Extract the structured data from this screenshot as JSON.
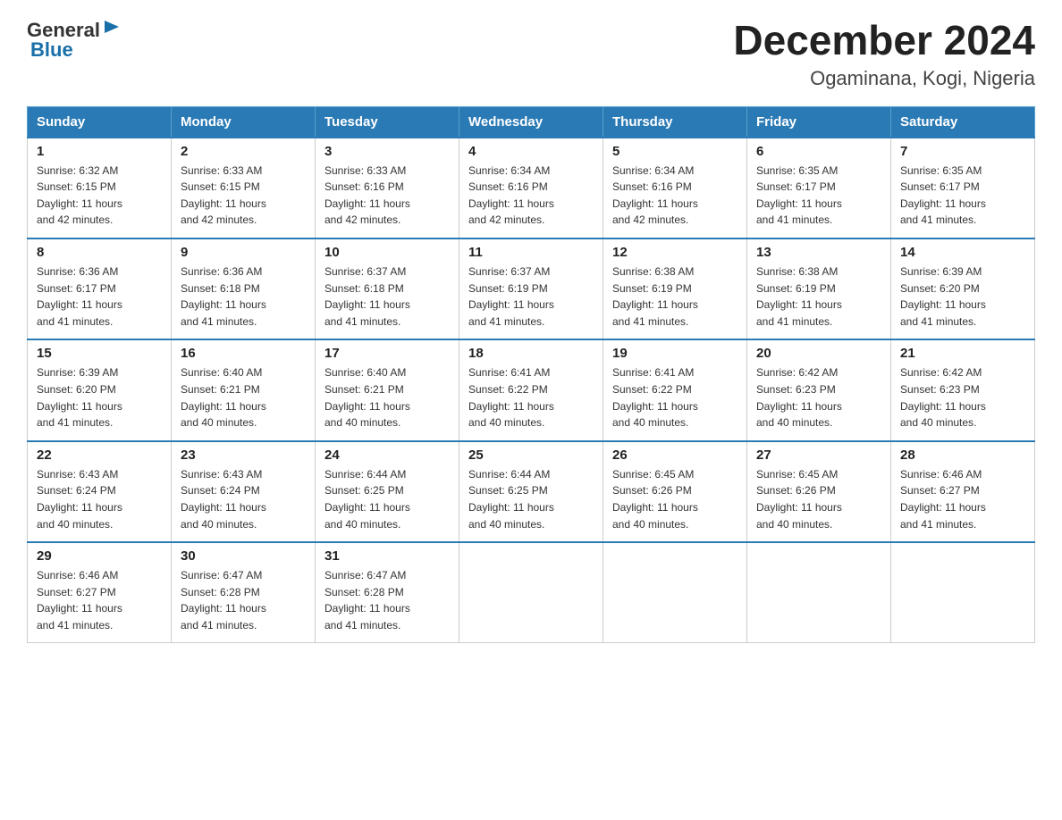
{
  "header": {
    "logo_general": "General",
    "logo_blue": "Blue",
    "month": "December 2024",
    "location": "Ogaminana, Kogi, Nigeria"
  },
  "weekdays": [
    "Sunday",
    "Monday",
    "Tuesday",
    "Wednesday",
    "Thursday",
    "Friday",
    "Saturday"
  ],
  "weeks": [
    [
      {
        "day": "1",
        "sunrise": "6:32 AM",
        "sunset": "6:15 PM",
        "daylight": "11 hours and 42 minutes."
      },
      {
        "day": "2",
        "sunrise": "6:33 AM",
        "sunset": "6:15 PM",
        "daylight": "11 hours and 42 minutes."
      },
      {
        "day": "3",
        "sunrise": "6:33 AM",
        "sunset": "6:16 PM",
        "daylight": "11 hours and 42 minutes."
      },
      {
        "day": "4",
        "sunrise": "6:34 AM",
        "sunset": "6:16 PM",
        "daylight": "11 hours and 42 minutes."
      },
      {
        "day": "5",
        "sunrise": "6:34 AM",
        "sunset": "6:16 PM",
        "daylight": "11 hours and 42 minutes."
      },
      {
        "day": "6",
        "sunrise": "6:35 AM",
        "sunset": "6:17 PM",
        "daylight": "11 hours and 41 minutes."
      },
      {
        "day": "7",
        "sunrise": "6:35 AM",
        "sunset": "6:17 PM",
        "daylight": "11 hours and 41 minutes."
      }
    ],
    [
      {
        "day": "8",
        "sunrise": "6:36 AM",
        "sunset": "6:17 PM",
        "daylight": "11 hours and 41 minutes."
      },
      {
        "day": "9",
        "sunrise": "6:36 AM",
        "sunset": "6:18 PM",
        "daylight": "11 hours and 41 minutes."
      },
      {
        "day": "10",
        "sunrise": "6:37 AM",
        "sunset": "6:18 PM",
        "daylight": "11 hours and 41 minutes."
      },
      {
        "day": "11",
        "sunrise": "6:37 AM",
        "sunset": "6:19 PM",
        "daylight": "11 hours and 41 minutes."
      },
      {
        "day": "12",
        "sunrise": "6:38 AM",
        "sunset": "6:19 PM",
        "daylight": "11 hours and 41 minutes."
      },
      {
        "day": "13",
        "sunrise": "6:38 AM",
        "sunset": "6:19 PM",
        "daylight": "11 hours and 41 minutes."
      },
      {
        "day": "14",
        "sunrise": "6:39 AM",
        "sunset": "6:20 PM",
        "daylight": "11 hours and 41 minutes."
      }
    ],
    [
      {
        "day": "15",
        "sunrise": "6:39 AM",
        "sunset": "6:20 PM",
        "daylight": "11 hours and 41 minutes."
      },
      {
        "day": "16",
        "sunrise": "6:40 AM",
        "sunset": "6:21 PM",
        "daylight": "11 hours and 40 minutes."
      },
      {
        "day": "17",
        "sunrise": "6:40 AM",
        "sunset": "6:21 PM",
        "daylight": "11 hours and 40 minutes."
      },
      {
        "day": "18",
        "sunrise": "6:41 AM",
        "sunset": "6:22 PM",
        "daylight": "11 hours and 40 minutes."
      },
      {
        "day": "19",
        "sunrise": "6:41 AM",
        "sunset": "6:22 PM",
        "daylight": "11 hours and 40 minutes."
      },
      {
        "day": "20",
        "sunrise": "6:42 AM",
        "sunset": "6:23 PM",
        "daylight": "11 hours and 40 minutes."
      },
      {
        "day": "21",
        "sunrise": "6:42 AM",
        "sunset": "6:23 PM",
        "daylight": "11 hours and 40 minutes."
      }
    ],
    [
      {
        "day": "22",
        "sunrise": "6:43 AM",
        "sunset": "6:24 PM",
        "daylight": "11 hours and 40 minutes."
      },
      {
        "day": "23",
        "sunrise": "6:43 AM",
        "sunset": "6:24 PM",
        "daylight": "11 hours and 40 minutes."
      },
      {
        "day": "24",
        "sunrise": "6:44 AM",
        "sunset": "6:25 PM",
        "daylight": "11 hours and 40 minutes."
      },
      {
        "day": "25",
        "sunrise": "6:44 AM",
        "sunset": "6:25 PM",
        "daylight": "11 hours and 40 minutes."
      },
      {
        "day": "26",
        "sunrise": "6:45 AM",
        "sunset": "6:26 PM",
        "daylight": "11 hours and 40 minutes."
      },
      {
        "day": "27",
        "sunrise": "6:45 AM",
        "sunset": "6:26 PM",
        "daylight": "11 hours and 40 minutes."
      },
      {
        "day": "28",
        "sunrise": "6:46 AM",
        "sunset": "6:27 PM",
        "daylight": "11 hours and 41 minutes."
      }
    ],
    [
      {
        "day": "29",
        "sunrise": "6:46 AM",
        "sunset": "6:27 PM",
        "daylight": "11 hours and 41 minutes."
      },
      {
        "day": "30",
        "sunrise": "6:47 AM",
        "sunset": "6:28 PM",
        "daylight": "11 hours and 41 minutes."
      },
      {
        "day": "31",
        "sunrise": "6:47 AM",
        "sunset": "6:28 PM",
        "daylight": "11 hours and 41 minutes."
      },
      null,
      null,
      null,
      null
    ]
  ],
  "labels": {
    "sunrise": "Sunrise:",
    "sunset": "Sunset:",
    "daylight": "Daylight:"
  }
}
